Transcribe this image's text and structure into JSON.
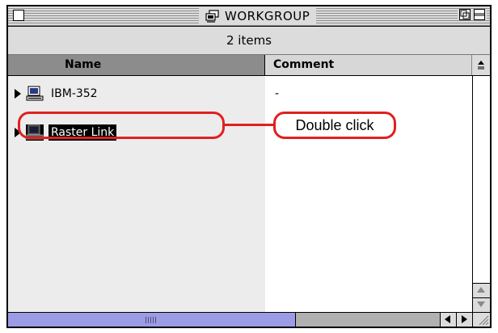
{
  "window": {
    "title": "WORKGROUP",
    "status": "2 items"
  },
  "columns": {
    "name": "Name",
    "comment": "Comment"
  },
  "rows": [
    {
      "name": "IBM-352",
      "comment": "-",
      "icon": "computer-icon",
      "selected": false
    },
    {
      "name": "Raster Link",
      "comment": "",
      "icon": "computer-icon",
      "selected": true
    }
  ],
  "annotation": {
    "callout": "Double click",
    "color": "#e02020"
  },
  "colors": {
    "selection": "#000000",
    "scroll_thumb": "#9c9ce6"
  }
}
